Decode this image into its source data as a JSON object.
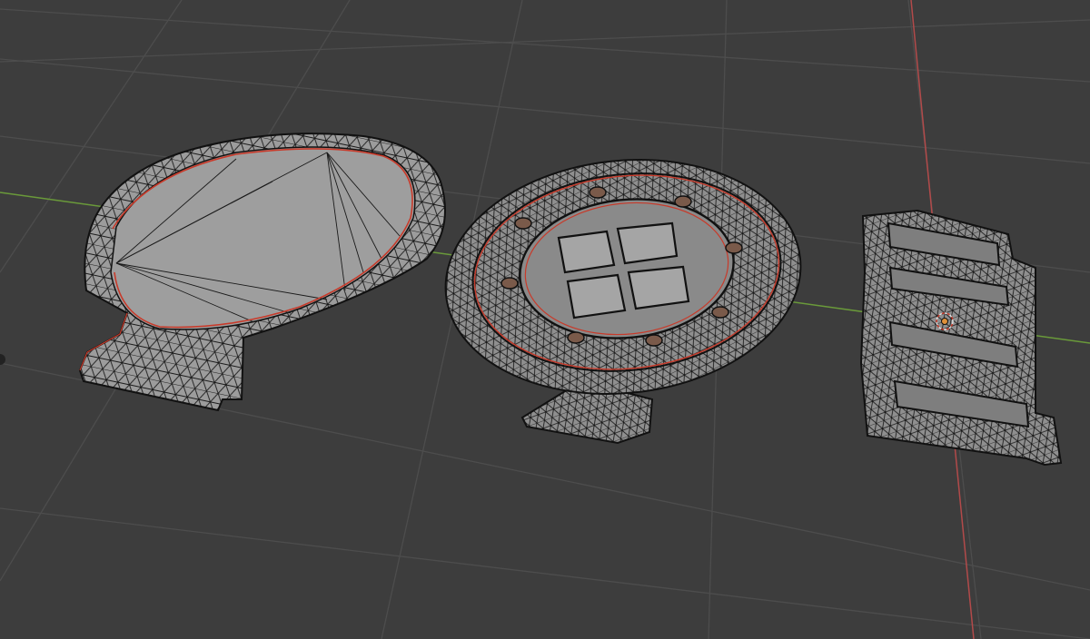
{
  "viewport": {
    "background_color": "#3d3d3d",
    "grid_color": "#4a4a4a",
    "x_axis_color": "#b24a4a",
    "y_axis_color": "#6a9a3a",
    "mesh_fill_color": "#9a9a9a",
    "mesh_edge_color": "#151515",
    "seam_color": "#c83a2a",
    "cursor_color": "#e0913a"
  },
  "objects": [
    {
      "name": "shell-shaped-lid",
      "shading": "wireframe-over-solid"
    },
    {
      "name": "round-puzzle-plate",
      "shading": "wireframe-over-solid"
    },
    {
      "name": "rectangular-slotted-plate",
      "shading": "wireframe-over-solid"
    }
  ],
  "scene": {
    "origin_marker": "3d-cursor-icon"
  }
}
